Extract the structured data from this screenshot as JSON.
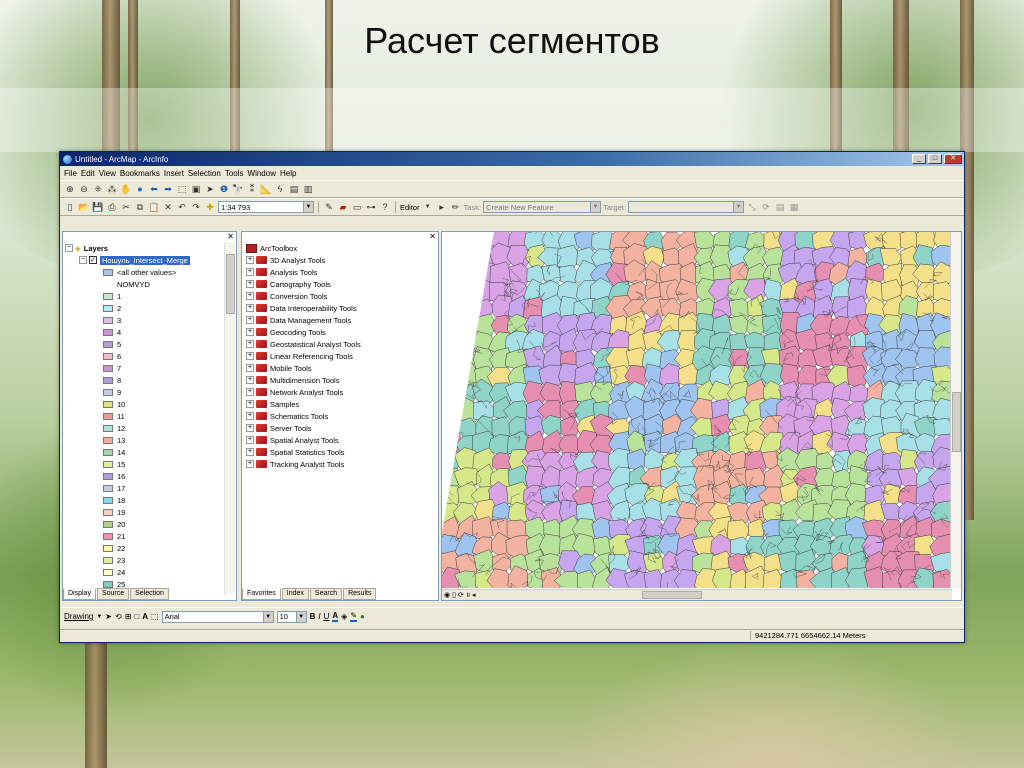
{
  "slide": {
    "title": "Расчет сегментов"
  },
  "window": {
    "title": "Untitled - ArcMap - ArcInfo",
    "controls": {
      "minimize": "_",
      "maximize": "□",
      "close": "✕"
    }
  },
  "menu": [
    "File",
    "Edit",
    "View",
    "Bookmarks",
    "Insert",
    "Selection",
    "Tools",
    "Window",
    "Help"
  ],
  "standard_toolbar": {
    "scale": "1:34 793",
    "editor_label": "Editor",
    "task_label": "Task:",
    "task_value": "Create New Feature",
    "target_label": "Target:"
  },
  "toc": {
    "root_label": "Layers",
    "layer_name": "Ношуль_Intersect_Merge",
    "other_values": "<all other values>",
    "field_name": "NOMVYD",
    "classes": [
      {
        "label": "1",
        "color": "#c8e6c9"
      },
      {
        "label": "2",
        "color": "#b2ebf2"
      },
      {
        "label": "3",
        "color": "#e1bee7"
      },
      {
        "label": "4",
        "color": "#ce93d8"
      },
      {
        "label": "5",
        "color": "#b39ddb"
      },
      {
        "label": "6",
        "color": "#f8bbd0"
      },
      {
        "label": "7",
        "color": "#ce93d8"
      },
      {
        "label": "8",
        "color": "#b39ddb"
      },
      {
        "label": "9",
        "color": "#c5cae9"
      },
      {
        "label": "10",
        "color": "#dce775"
      },
      {
        "label": "11",
        "color": "#ef9a9a"
      },
      {
        "label": "12",
        "color": "#b2dfdb"
      },
      {
        "label": "13",
        "color": "#ffab91"
      },
      {
        "label": "14",
        "color": "#a5d6a7"
      },
      {
        "label": "15",
        "color": "#e6ee9c"
      },
      {
        "label": "16",
        "color": "#b39ddb"
      },
      {
        "label": "17",
        "color": "#c5cae9"
      },
      {
        "label": "18",
        "color": "#80deea"
      },
      {
        "label": "19",
        "color": "#ffccbc"
      },
      {
        "label": "20",
        "color": "#aed581"
      },
      {
        "label": "21",
        "color": "#f48fb1"
      },
      {
        "label": "22",
        "color": "#fff59d"
      },
      {
        "label": "23",
        "color": "#e6ee9c"
      },
      {
        "label": "24",
        "color": "#fff9c4"
      },
      {
        "label": "25",
        "color": "#80cbc4"
      }
    ],
    "tabs": [
      "Display",
      "Source",
      "Selection"
    ]
  },
  "toolbox": {
    "root_label": "ArcToolbox",
    "tools": [
      "3D Analyst Tools",
      "Analysis Tools",
      "Cartography Tools",
      "Conversion Tools",
      "Data Interoperability Tools",
      "Data Management Tools",
      "Geocoding Tools",
      "Geostatistical Analyst Tools",
      "Linear Referencing Tools",
      "Mobile Tools",
      "Multidimension Tools",
      "Network Analyst Tools",
      "Samples",
      "Schematics Tools",
      "Server Tools",
      "Spatial Analyst Tools",
      "Spatial Statistics Tools",
      "Tracking Analyst Tools"
    ],
    "tabs": [
      "Favorites",
      "Index",
      "Search",
      "Results"
    ]
  },
  "drawing_toolbar": {
    "drawing_label": "Drawing",
    "font": "Arial",
    "size": "10",
    "bold": "B",
    "italic": "I",
    "underline": "U"
  },
  "status": {
    "coordinates": "9421284.771  6654662.14 Meters"
  },
  "map_palette": [
    "#d9a3e6",
    "#a8e0e8",
    "#f3b3a0",
    "#b9e39b",
    "#c7a6f0",
    "#f5e08a",
    "#8fd4c9",
    "#e68fb0",
    "#a0c4f0",
    "#d6e88a"
  ]
}
